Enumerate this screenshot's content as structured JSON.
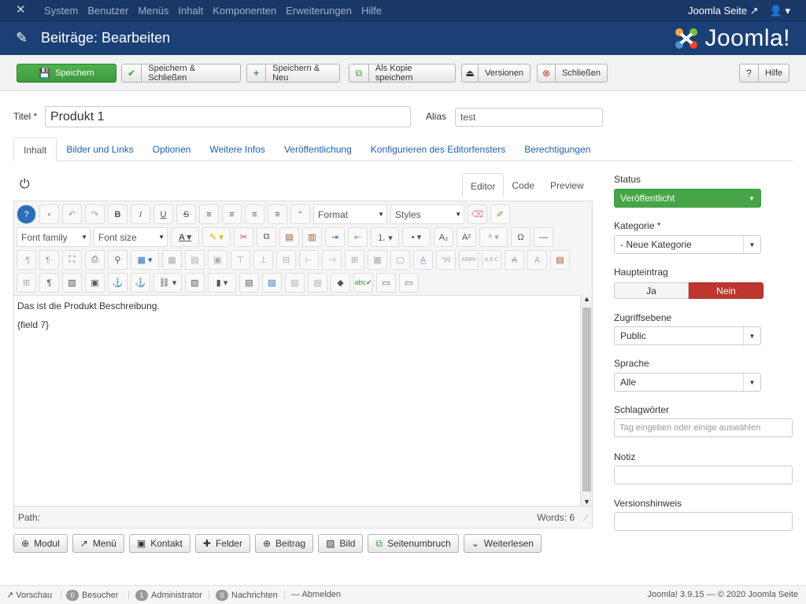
{
  "topbar": {
    "menu": [
      "System",
      "Benutzer",
      "Menüs",
      "Inhalt",
      "Komponenten",
      "Erweiterungen",
      "Hilfe"
    ],
    "site_link": "Joomla Seite",
    "user_icon": "user-icon"
  },
  "header": {
    "title": "Beiträge: Bearbeiten",
    "brand": "Joomla!"
  },
  "toolbar": {
    "save": "Speichern",
    "save_close": "Speichern & Schließen",
    "save_new": "Speichern & Neu",
    "save_copy": "Als Kopie speichern",
    "versions": "Versionen",
    "close": "Schließen",
    "help": "Hilfe"
  },
  "form": {
    "title_label": "Titel *",
    "title_value": "Produkt 1",
    "alias_label": "Alias",
    "alias_value": "test"
  },
  "tabs": [
    "Inhalt",
    "Bilder und Links",
    "Optionen",
    "Weitere Infos",
    "Veröffentlichung",
    "Konfigurieren des Editorfensters",
    "Berechtigungen"
  ],
  "editor": {
    "tabs": [
      "Editor",
      "Code",
      "Preview"
    ],
    "format": "Format",
    "styles": "Styles",
    "font_family": "Font family",
    "font_size": "Font size",
    "content": [
      "Das ist die Produkt Beschreibung.",
      "{field 7}"
    ],
    "path": "Path:",
    "words": "Words: 6"
  },
  "extra_buttons": [
    "Modul",
    "Menü",
    "Kontakt",
    "Felder",
    "Beitrag",
    "Bild",
    "Seitenumbruch",
    "Weiterlesen"
  ],
  "sidebar": {
    "status_label": "Status",
    "status_value": "Veröffentlicht",
    "category_label": "Kategorie *",
    "category_value": "- Neue Kategorie",
    "featured_label": "Haupteintrag",
    "featured_yes": "Ja",
    "featured_no": "Nein",
    "access_label": "Zugriffsebene",
    "access_value": "Public",
    "language_label": "Sprache",
    "language_value": "Alle",
    "tags_label": "Schlagwörter",
    "tags_placeholder": "Tag eingeben oder einige auswählen",
    "note_label": "Notiz",
    "version_label": "Versionshinweis"
  },
  "footer": {
    "preview": "Vorschau",
    "visitors_count": "0",
    "visitors": "Besucher",
    "admin_count": "1",
    "admin": "Administrator",
    "messages_count": "0",
    "messages": "Nachrichten",
    "logout": "Abmelden",
    "version": "Joomla! 3.9.15 — © 2020 Joomla Seite"
  },
  "colors": {
    "topbar": "#1a3867",
    "header": "#1a4076",
    "success": "#3d9a3d",
    "danger": "#bd362f"
  }
}
